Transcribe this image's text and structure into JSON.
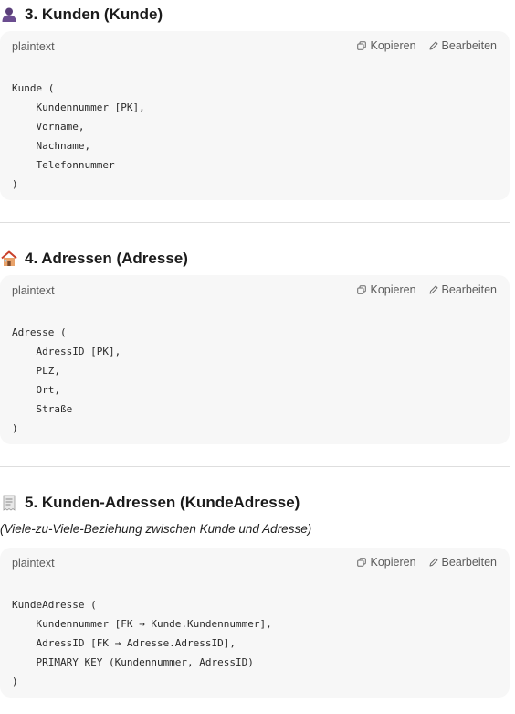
{
  "sections": [
    {
      "emoji": "person-icon",
      "heading": "3. Kunden (Kunde)",
      "code": {
        "language": "plaintext",
        "copy_label": "Kopieren",
        "edit_label": "Bearbeiten",
        "lines": [
          "Kunde (",
          "    Kundennummer [PK],",
          "    Vorname,",
          "    Nachname,",
          "    Telefonnummer",
          ")"
        ]
      }
    },
    {
      "emoji": "house-icon",
      "heading": "4. Adressen (Adresse)",
      "code": {
        "language": "plaintext",
        "copy_label": "Kopieren",
        "edit_label": "Bearbeiten",
        "lines": [
          "Adresse (",
          "    AdressID [PK],",
          "    PLZ,",
          "    Ort,",
          "    Straße",
          ")"
        ]
      }
    },
    {
      "emoji": "receipt-icon",
      "heading": "5. Kunden-Adressen (KundeAdresse)",
      "subtitle": "(Viele-zu-Viele-Beziehung zwischen Kunde und Adresse)",
      "code": {
        "language": "plaintext",
        "copy_label": "Kopieren",
        "edit_label": "Bearbeiten",
        "lines": [
          "KundeAdresse (",
          "    Kundennummer [FK → Kunde.Kundennummer],",
          "    AdressID [FK → Adresse.AdressID],",
          "    PRIMARY KEY (Kundennummer, AdressID)",
          ")"
        ]
      }
    }
  ]
}
